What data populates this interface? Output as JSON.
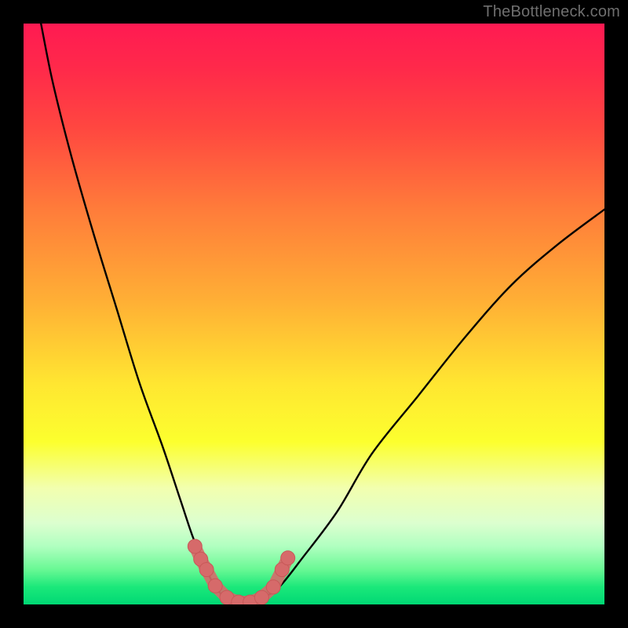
{
  "watermark": {
    "text": "TheBottleneck.com"
  },
  "colors": {
    "frame": "#000000",
    "curve_stroke": "#000000",
    "marker_fill": "#d66a6a",
    "marker_stroke": "#c85858",
    "watermark": "#6f6f6f"
  },
  "chart_data": {
    "type": "line",
    "title": "",
    "xlabel": "",
    "ylabel": "",
    "xlim": [
      0,
      100
    ],
    "ylim": [
      0,
      100
    ],
    "grid": false,
    "legend": false,
    "series": [
      {
        "name": "bottleneck-curve",
        "x": [
          3,
          5,
          8,
          12,
          16,
          20,
          24,
          27,
          29,
          31,
          33,
          35,
          37,
          39,
          41,
          44,
          48,
          54,
          60,
          68,
          76,
          84,
          92,
          100
        ],
        "values": [
          100,
          90,
          78,
          64,
          51,
          38,
          27,
          18,
          12,
          7,
          3,
          1,
          0,
          0,
          1,
          3,
          8,
          16,
          26,
          36,
          46,
          55,
          62,
          68
        ]
      }
    ],
    "markers": {
      "name": "bottom-cluster",
      "x": [
        29.5,
        30.5,
        31.5,
        33.0,
        35.0,
        37.0,
        39.0,
        41.0,
        43.0,
        44.5,
        45.5
      ],
      "values": [
        10.0,
        7.8,
        6.0,
        3.2,
        1.2,
        0.4,
        0.4,
        1.2,
        3.0,
        6.0,
        8.0
      ]
    }
  }
}
